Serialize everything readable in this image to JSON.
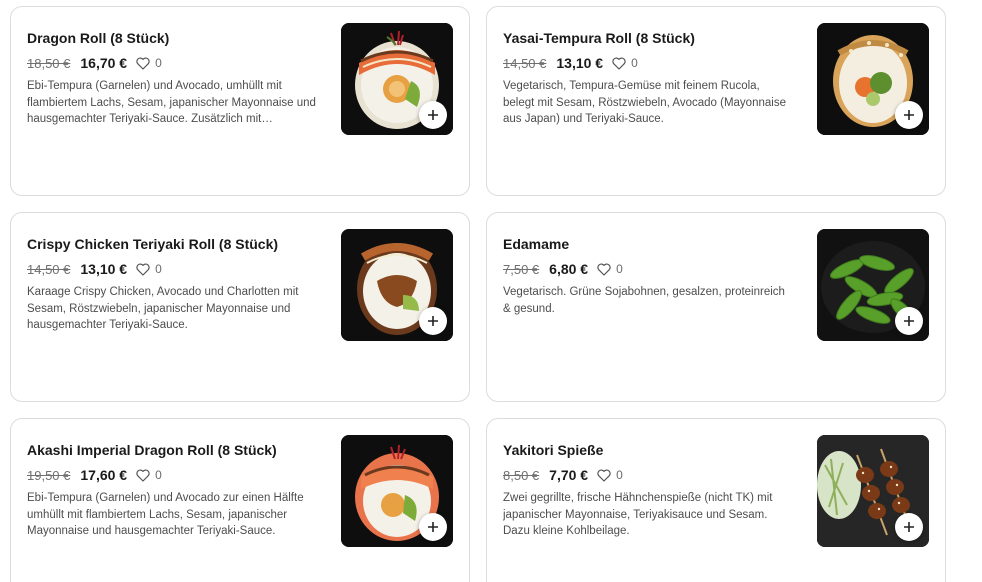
{
  "currency_note": "",
  "items": [
    {
      "title": "Dragon Roll (8 Stück)",
      "old_price": "18,50 €",
      "price": "16,70 €",
      "likes": "0",
      "description": "Ebi-Tempura (Garnelen) und Avocado, umhüllt mit flambiertem Lachs, Sesam, japanischer Mayonnaise und hausgemachter Teriyaki-Sauce. Zusätzlich mit Röstzwiebeln und Sprossen garniert.",
      "image": "dragon-roll",
      "add_icon": "plus-icon"
    },
    {
      "title": "Yasai-Tempura Roll (8 Stück)",
      "old_price": "14,50 €",
      "price": "13,10 €",
      "likes": "0",
      "description": "Vegetarisch, Tempura-Gemüse mit feinem Rucola, belegt mit Sesam, Röstzwiebeln, Avocado (Mayonnaise aus Japan) und Teriyaki-Sauce.",
      "image": "yasai-roll",
      "add_icon": "plus-icon"
    },
    {
      "title": "Crispy Chicken Teriyaki Roll (8 Stück)",
      "old_price": "14,50 €",
      "price": "13,10 €",
      "likes": "0",
      "description": "Karaage Crispy Chicken, Avocado und Charlotten mit Sesam, Röstzwiebeln, japanischer Mayonnaise und hausgemachter Teriyaki-Sauce.",
      "image": "chicken-roll",
      "add_icon": "plus-icon"
    },
    {
      "title": "Edamame",
      "old_price": "7,50 €",
      "price": "6,80 €",
      "likes": "0",
      "description": "Vegetarisch. Grüne Sojabohnen, gesalzen, proteinreich & gesund.",
      "image": "edamame",
      "add_icon": "plus-icon"
    },
    {
      "title": "Akashi Imperial Dragon Roll (8 Stück)",
      "old_price": "19,50 €",
      "price": "17,60 €",
      "likes": "0",
      "description": "Ebi-Tempura (Garnelen) und Avocado zur einen Hälfte umhüllt mit flambiertem Lachs, Sesam, japanischer Mayonnaise und hausgemachter Teriyaki-Sauce.",
      "image": "akashi-roll",
      "add_icon": "plus-icon"
    },
    {
      "title": "Yakitori Spieße",
      "old_price": "8,50 €",
      "price": "7,70 €",
      "likes": "0",
      "description": "Zwei gegrillte, frische Hähnchenspieße (nicht TK) mit japanischer Mayonnaise, Teriyakisauce und Sesam. Dazu kleine Kohlbeilage.",
      "image": "yakitori",
      "add_icon": "plus-icon"
    }
  ]
}
